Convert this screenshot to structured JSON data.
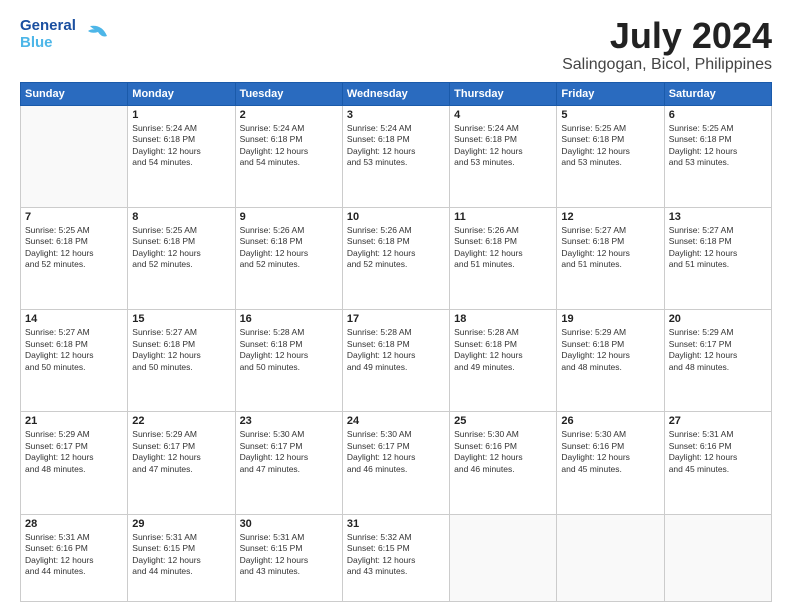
{
  "header": {
    "logo_general": "General",
    "logo_blue": "Blue",
    "month": "July 2024",
    "location": "Salingogan, Bicol, Philippines"
  },
  "days_of_week": [
    "Sunday",
    "Monday",
    "Tuesday",
    "Wednesday",
    "Thursday",
    "Friday",
    "Saturday"
  ],
  "weeks": [
    [
      {
        "day": "",
        "info": ""
      },
      {
        "day": "1",
        "info": "Sunrise: 5:24 AM\nSunset: 6:18 PM\nDaylight: 12 hours\nand 54 minutes."
      },
      {
        "day": "2",
        "info": "Sunrise: 5:24 AM\nSunset: 6:18 PM\nDaylight: 12 hours\nand 54 minutes."
      },
      {
        "day": "3",
        "info": "Sunrise: 5:24 AM\nSunset: 6:18 PM\nDaylight: 12 hours\nand 53 minutes."
      },
      {
        "day": "4",
        "info": "Sunrise: 5:24 AM\nSunset: 6:18 PM\nDaylight: 12 hours\nand 53 minutes."
      },
      {
        "day": "5",
        "info": "Sunrise: 5:25 AM\nSunset: 6:18 PM\nDaylight: 12 hours\nand 53 minutes."
      },
      {
        "day": "6",
        "info": "Sunrise: 5:25 AM\nSunset: 6:18 PM\nDaylight: 12 hours\nand 53 minutes."
      }
    ],
    [
      {
        "day": "7",
        "info": "Sunrise: 5:25 AM\nSunset: 6:18 PM\nDaylight: 12 hours\nand 52 minutes."
      },
      {
        "day": "8",
        "info": "Sunrise: 5:25 AM\nSunset: 6:18 PM\nDaylight: 12 hours\nand 52 minutes."
      },
      {
        "day": "9",
        "info": "Sunrise: 5:26 AM\nSunset: 6:18 PM\nDaylight: 12 hours\nand 52 minutes."
      },
      {
        "day": "10",
        "info": "Sunrise: 5:26 AM\nSunset: 6:18 PM\nDaylight: 12 hours\nand 52 minutes."
      },
      {
        "day": "11",
        "info": "Sunrise: 5:26 AM\nSunset: 6:18 PM\nDaylight: 12 hours\nand 51 minutes."
      },
      {
        "day": "12",
        "info": "Sunrise: 5:27 AM\nSunset: 6:18 PM\nDaylight: 12 hours\nand 51 minutes."
      },
      {
        "day": "13",
        "info": "Sunrise: 5:27 AM\nSunset: 6:18 PM\nDaylight: 12 hours\nand 51 minutes."
      }
    ],
    [
      {
        "day": "14",
        "info": "Sunrise: 5:27 AM\nSunset: 6:18 PM\nDaylight: 12 hours\nand 50 minutes."
      },
      {
        "day": "15",
        "info": "Sunrise: 5:27 AM\nSunset: 6:18 PM\nDaylight: 12 hours\nand 50 minutes."
      },
      {
        "day": "16",
        "info": "Sunrise: 5:28 AM\nSunset: 6:18 PM\nDaylight: 12 hours\nand 50 minutes."
      },
      {
        "day": "17",
        "info": "Sunrise: 5:28 AM\nSunset: 6:18 PM\nDaylight: 12 hours\nand 49 minutes."
      },
      {
        "day": "18",
        "info": "Sunrise: 5:28 AM\nSunset: 6:18 PM\nDaylight: 12 hours\nand 49 minutes."
      },
      {
        "day": "19",
        "info": "Sunrise: 5:29 AM\nSunset: 6:18 PM\nDaylight: 12 hours\nand 48 minutes."
      },
      {
        "day": "20",
        "info": "Sunrise: 5:29 AM\nSunset: 6:17 PM\nDaylight: 12 hours\nand 48 minutes."
      }
    ],
    [
      {
        "day": "21",
        "info": "Sunrise: 5:29 AM\nSunset: 6:17 PM\nDaylight: 12 hours\nand 48 minutes."
      },
      {
        "day": "22",
        "info": "Sunrise: 5:29 AM\nSunset: 6:17 PM\nDaylight: 12 hours\nand 47 minutes."
      },
      {
        "day": "23",
        "info": "Sunrise: 5:30 AM\nSunset: 6:17 PM\nDaylight: 12 hours\nand 47 minutes."
      },
      {
        "day": "24",
        "info": "Sunrise: 5:30 AM\nSunset: 6:17 PM\nDaylight: 12 hours\nand 46 minutes."
      },
      {
        "day": "25",
        "info": "Sunrise: 5:30 AM\nSunset: 6:16 PM\nDaylight: 12 hours\nand 46 minutes."
      },
      {
        "day": "26",
        "info": "Sunrise: 5:30 AM\nSunset: 6:16 PM\nDaylight: 12 hours\nand 45 minutes."
      },
      {
        "day": "27",
        "info": "Sunrise: 5:31 AM\nSunset: 6:16 PM\nDaylight: 12 hours\nand 45 minutes."
      }
    ],
    [
      {
        "day": "28",
        "info": "Sunrise: 5:31 AM\nSunset: 6:16 PM\nDaylight: 12 hours\nand 44 minutes."
      },
      {
        "day": "29",
        "info": "Sunrise: 5:31 AM\nSunset: 6:15 PM\nDaylight: 12 hours\nand 44 minutes."
      },
      {
        "day": "30",
        "info": "Sunrise: 5:31 AM\nSunset: 6:15 PM\nDaylight: 12 hours\nand 43 minutes."
      },
      {
        "day": "31",
        "info": "Sunrise: 5:32 AM\nSunset: 6:15 PM\nDaylight: 12 hours\nand 43 minutes."
      },
      {
        "day": "",
        "info": ""
      },
      {
        "day": "",
        "info": ""
      },
      {
        "day": "",
        "info": ""
      }
    ]
  ]
}
